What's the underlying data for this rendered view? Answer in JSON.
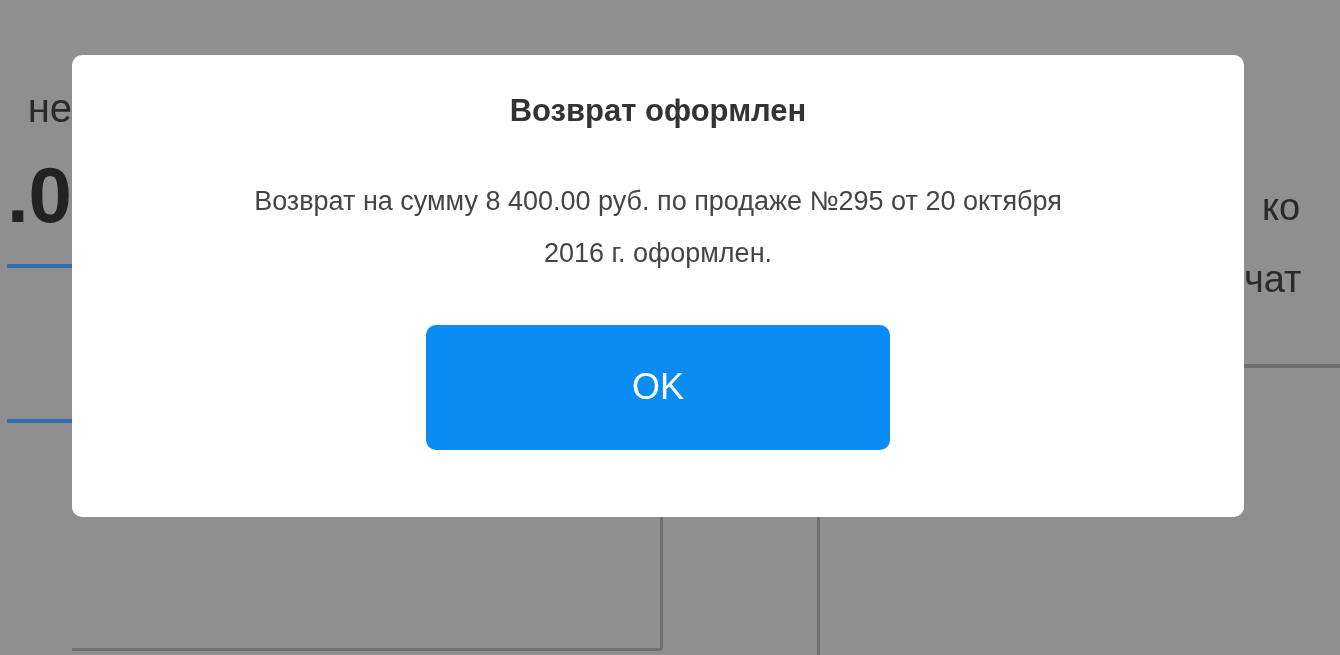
{
  "background": {
    "left_texts": [
      "не",
      ".0"
    ],
    "right_texts": [
      "ко",
      "чат"
    ]
  },
  "dialog": {
    "title": "Возврат оформлен",
    "message": "Возврат на сумму 8 400.00 руб. по продаже №295 от 20 октября 2016 г. оформлен.",
    "buttons": [
      {
        "label": "OK"
      }
    ]
  }
}
